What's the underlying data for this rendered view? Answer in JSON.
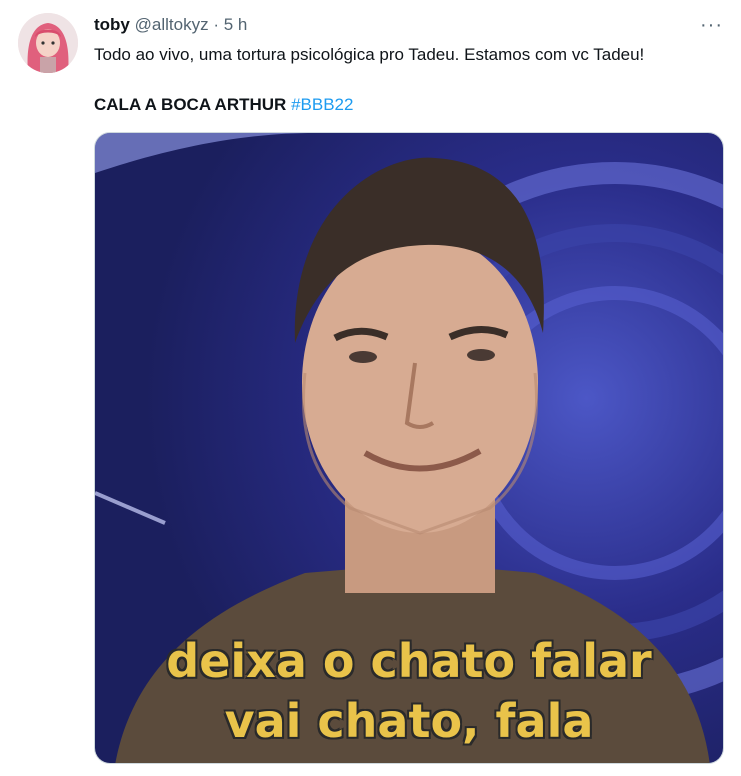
{
  "tweet": {
    "author_name": "toby",
    "author_handle": "@alltokyz",
    "separator": "·",
    "time": "5 h",
    "more_label": "···",
    "text_line1": "Todo ao vivo, uma tortura psicológica pro Tadeu. Estamos com vc Tadeu!",
    "text_line2_main": "CALA A BOCA ARTHUR",
    "hashtag": "#BBB22"
  },
  "media": {
    "caption_line1": "deixa o chato falar",
    "caption_line2": "vai chato, fala"
  },
  "colors": {
    "hashtag": "#1d9bf0",
    "secondary_text": "#536471",
    "caption": "#e9c34a"
  },
  "icons": [
    "more-icon",
    "avatar-image",
    "meme-image"
  ]
}
